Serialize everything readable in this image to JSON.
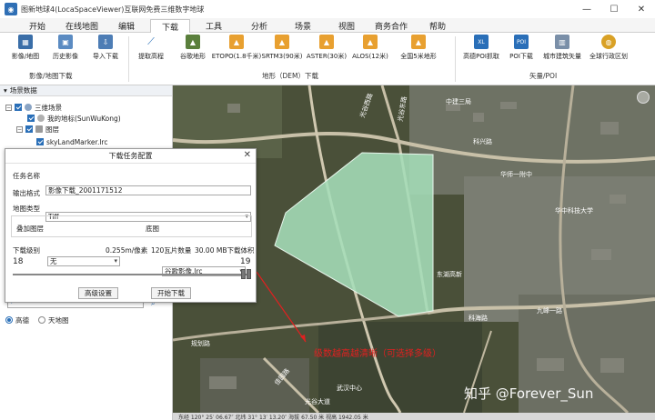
{
  "app": {
    "title": "图新地球4(LocaSpaceViewer)互联网免费三维数字地球",
    "icon": "globe-icon"
  },
  "window_controls": {
    "minimize": "—",
    "maximize": "☐",
    "close": "✕"
  },
  "menu_tabs": [
    "开始",
    "在线地图",
    "编辑",
    "下载",
    "工具",
    "分析",
    "场景",
    "视图",
    "商务合作",
    "帮助"
  ],
  "active_tab": "下载",
  "ribbon": {
    "group1": {
      "label": "影像/地图下载",
      "buttons": [
        "影像/地图",
        "历史影像",
        "导入下载"
      ]
    },
    "group2": {
      "label": "地形（DEM）下载",
      "buttons": [
        "提取高程",
        "谷歌地形",
        "ETOPO(1.8千米)",
        "SRTM3(90米)",
        "ASTER(30米)",
        "ALOS(12米)",
        "全国5米地形"
      ]
    },
    "group3": {
      "label": "矢量/POI",
      "buttons": [
        "高德POI抓取",
        "POI下载",
        "城市建筑矢量",
        "全球行政区划"
      ]
    }
  },
  "sidebar": {
    "header": "场景数据",
    "tree": {
      "root": "三维场景",
      "my_marks": "我的地标(SunWuKong)",
      "layers": "图层",
      "marker_file": "skyLandMarker.lrc"
    },
    "radio": {
      "option1": "高德",
      "option2": "天地图"
    }
  },
  "dialog": {
    "title": "下载任务配置",
    "close": "✕",
    "task_name_label": "任务名称",
    "task_name_value": "影像下载_2001171512",
    "format_label": "输出格式",
    "format_value": "Tiff",
    "map_type_label": "地图类型",
    "overlay_label": "叠加图层",
    "overlay_value": "无",
    "base_label": "底图",
    "base_value": "谷歌影像.lrc",
    "level_label": "下载级别",
    "resolution": "0.255m/像素",
    "tiles": "120瓦片数量",
    "size": "30.00 MB下载体积",
    "level_min": "18",
    "level_max": "19",
    "level_low_fraction": 0.98,
    "level_high_fraction": 1.0,
    "advanced_button": "高级设置",
    "start_button": "开始下载"
  },
  "map": {
    "labels": [
      "光谷西路",
      "光谷东路",
      "科兴路",
      "中建三局",
      "东湖高新",
      "华中科技大学",
      "华师一附中",
      "科海路",
      "规划路",
      "九峰一路",
      "佳园路",
      "光谷大道",
      "武汉中心"
    ],
    "annotation": "级数越高越清晰（可选择多级）",
    "watermark": "知乎 @Forever_Sun",
    "annotation_color": "#e02020",
    "polygon_color": "#a5ddb8"
  },
  "status": {
    "text": "东经 120° 25′ 06.67″  北纬 31° 13′ 13.20″  海拔 67.50 米  视高 1942.05 米"
  }
}
